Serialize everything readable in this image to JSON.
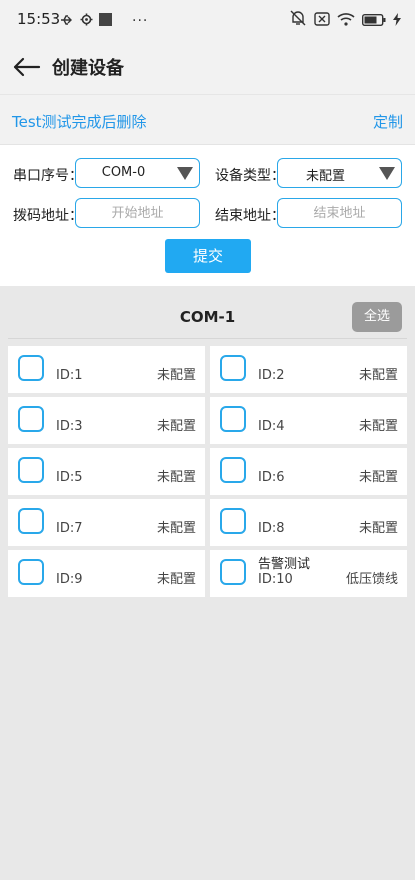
{
  "status_bar": {
    "time": "15:53",
    "left_icons": [
      "usb-icon",
      "settings-gear-icon",
      "app-square-icon"
    ],
    "more": "···",
    "right_icons": [
      "mute-vibrate-icon",
      "no-sim-icon",
      "wifi-icon",
      "battery-icon",
      "charging-bolt-icon"
    ]
  },
  "header": {
    "back_icon": "arrow-left-icon",
    "title": "创建设备"
  },
  "subheader": {
    "left_link": "Test测试完成后删除",
    "right_link": "定制"
  },
  "form": {
    "serial_label": "串口序号：",
    "serial_value": "COM-0",
    "device_type_label": "设备类型：",
    "device_type_value": "未配置",
    "dial_label": "拨码地址：",
    "dial_placeholder": "开始地址",
    "end_label": "结束地址：",
    "end_placeholder": "结束地址",
    "submit_label": "提交"
  },
  "section": {
    "title": "COM-1",
    "select_all_label": "全选"
  },
  "devices": [
    {
      "name": "",
      "id": "ID:1",
      "type": "未配置",
      "checked": false
    },
    {
      "name": "",
      "id": "ID:2",
      "type": "未配置",
      "checked": false
    },
    {
      "name": "",
      "id": "ID:3",
      "type": "未配置",
      "checked": false
    },
    {
      "name": "",
      "id": "ID:4",
      "type": "未配置",
      "checked": false
    },
    {
      "name": "",
      "id": "ID:5",
      "type": "未配置",
      "checked": false
    },
    {
      "name": "",
      "id": "ID:6",
      "type": "未配置",
      "checked": false
    },
    {
      "name": "",
      "id": "ID:7",
      "type": "未配置",
      "checked": false
    },
    {
      "name": "",
      "id": "ID:8",
      "type": "未配置",
      "checked": false
    },
    {
      "name": "",
      "id": "ID:9",
      "type": "未配置",
      "checked": false
    },
    {
      "name": "告警测试",
      "id": "ID:10",
      "type": "低压馈线",
      "checked": false
    }
  ],
  "colors": {
    "accent": "#2196e8",
    "border_blue": "#2aa7e8",
    "button_blue": "#21a9f2",
    "select_all_gray": "#9b9b9b",
    "background": "#e8e8e8"
  }
}
